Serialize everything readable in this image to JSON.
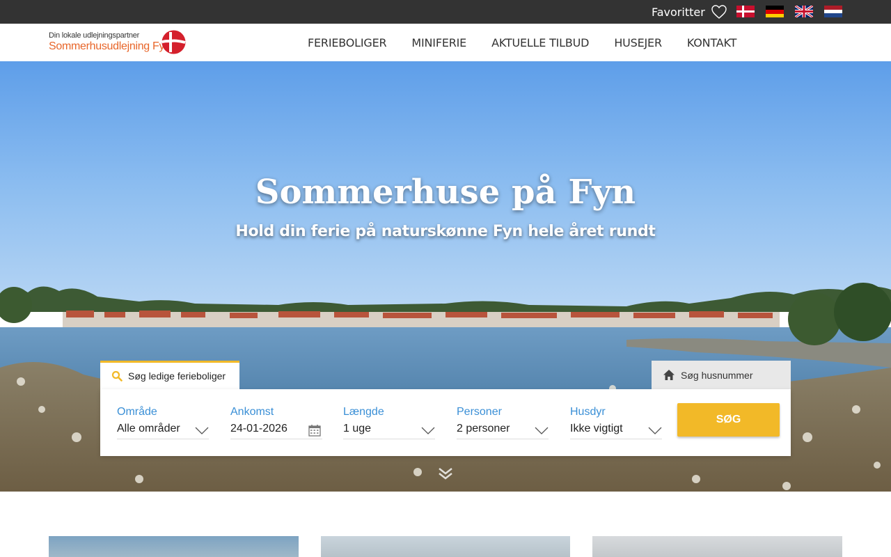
{
  "topbar": {
    "favorites_label": "Favoritter",
    "icons": [
      "heart-icon"
    ],
    "languages": [
      "flag-denmark",
      "flag-germany",
      "flag-uk",
      "flag-netherlands"
    ]
  },
  "header": {
    "logo_tagline": "Din lokale udlejningspartner",
    "logo_name": "Sommerhusudlejning Fyn",
    "nav": [
      "FERIEBOLIGER",
      "MINIFERIE",
      "AKTUELLE TILBUD",
      "HUSEJER",
      "KONTAKT"
    ]
  },
  "hero": {
    "title": "Sommerhuse på Fyn",
    "subtitle": "Hold din ferie på naturskønne Fyn hele året rundt"
  },
  "search": {
    "tab_available": "Søg ledige ferieboliger",
    "tab_house_number": "Søg husnummer",
    "fields": [
      {
        "label": "Område",
        "value": "Alle områder"
      },
      {
        "label": "Ankomst",
        "value": "24-01-2026"
      },
      {
        "label": "Længde",
        "value": "1 uge"
      },
      {
        "label": "Personer",
        "value": "2 personer"
      },
      {
        "label": "Husdyr",
        "value": "Ikke vigtigt"
      }
    ],
    "submit_label": "SØG"
  },
  "colors": {
    "accent": "#f2b928",
    "label_blue": "#3a8fd6",
    "topbar": "#333333",
    "logo_orange": "#e8662a"
  }
}
